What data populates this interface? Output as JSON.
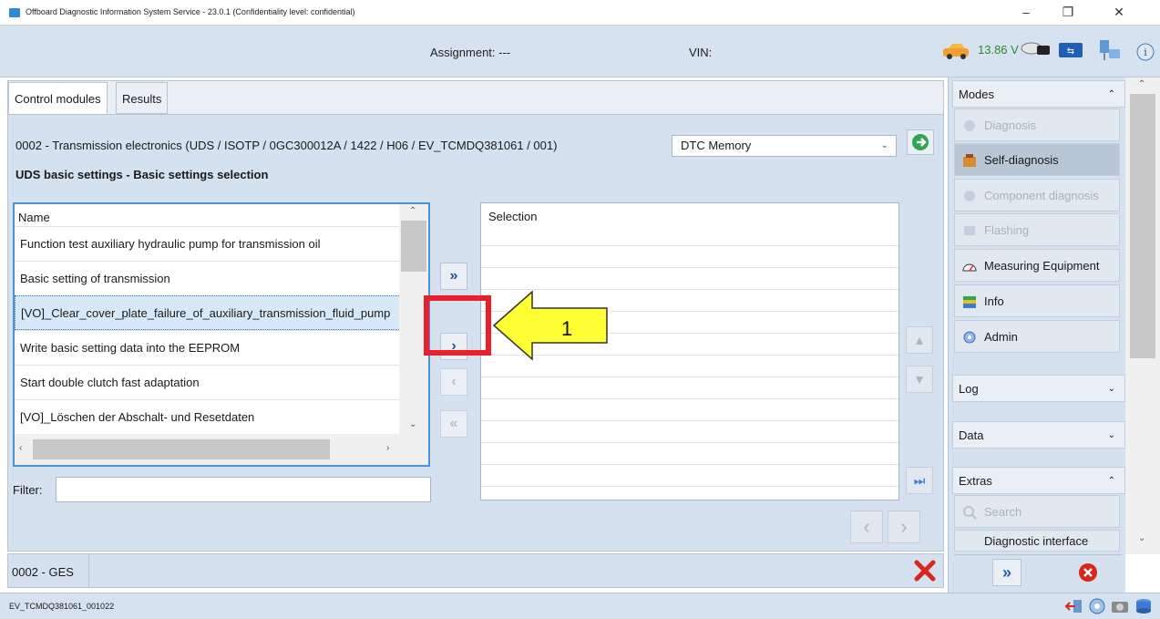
{
  "window": {
    "title": "Offboard Diagnostic Information System Service - 23.0.1 (Confidentiality level: confidential)",
    "minimize": "–",
    "maximize": "❐",
    "close": "✕"
  },
  "header": {
    "assignment": "Assignment: ---",
    "vin": "VIN:",
    "voltage": "13.86 V"
  },
  "tabs": [
    "Control modules",
    "Results"
  ],
  "control_module": "0002 - Transmission electronics  (UDS / ISOTP / 0GC300012A / 1422 / H06 / EV_TCMDQ381061 / 001)",
  "dtc_dropdown": "DTC Memory",
  "section_heading": "UDS basic settings - Basic settings selection",
  "name_list": {
    "header": "Name",
    "items": [
      "Function test auxiliary hydraulic pump for transmission oil",
      "Basic setting of transmission",
      "[VO]_Clear_cover_plate_failure_of_auxiliary_transmission_fluid_pump",
      "Write basic setting data into the EEPROM",
      "Start double clutch fast adaptation",
      "[VO]_Löschen der Abschalt- und Resetdaten"
    ],
    "selected_index": 2
  },
  "selection_list": {
    "header": "Selection"
  },
  "transfer_buttons": {
    "add_all": "»",
    "add": "›",
    "remove": "‹",
    "remove_all": "«"
  },
  "filter": {
    "label": "Filter:",
    "value": ""
  },
  "status": {
    "ecu_short": "0002 - GES"
  },
  "bottom": {
    "id": "EV_TCMDQ381061_001022"
  },
  "sidebar": {
    "modes_header": "Modes",
    "modes": [
      {
        "label": "Diagnosis",
        "state": "disabled"
      },
      {
        "label": "Self-diagnosis",
        "state": "active"
      },
      {
        "label": "Component diagnosis",
        "state": "disabled"
      },
      {
        "label": "Flashing",
        "state": "disabled"
      },
      {
        "label": "Measuring Equipment",
        "state": "enabled"
      },
      {
        "label": "Info",
        "state": "enabled"
      },
      {
        "label": "Admin",
        "state": "enabled"
      }
    ],
    "log_header": "Log",
    "data_header": "Data",
    "extras_header": "Extras",
    "extras": [
      {
        "label": "Search",
        "state": "disabled"
      },
      {
        "label": "Diagnostic interface",
        "state": "enabled"
      }
    ]
  },
  "annotation": {
    "label": "1",
    "color": "#e8202a",
    "arrow_color": "#ffff33"
  },
  "colors": {
    "panel": "#d5e1ee",
    "accent": "#4a93d6",
    "go_green": "#2fa84f",
    "cancel_red": "#d9261c"
  }
}
